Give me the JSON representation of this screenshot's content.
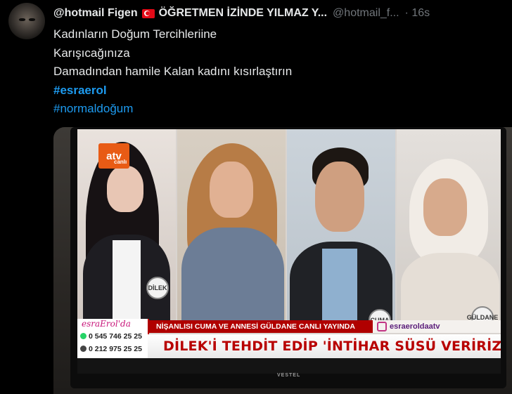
{
  "tweet": {
    "display_name": "@hotmail Figen",
    "display_name_suffix": "ÖĞRETMEN İZİNDE YILMAZ Y...",
    "handle": "@hotmail_f...",
    "time": "· 16s",
    "text_lines": [
      "Kadınların Doğum Tercihleriine",
      "Karışıcağınıza",
      "Damadından hamile Kalan kadını kısırlaştırın"
    ],
    "hashtags": [
      "#esraerol",
      "#normaldoğum"
    ]
  },
  "media": {
    "channel_logo": "atv",
    "channel_sub": "canlı",
    "show_logo": "esraErol'da",
    "phones": [
      "0 545 746 25 25",
      "0 212 975 25 25"
    ],
    "ticker": "NİŞANLISI CUMA VE ANNESİ GÜLDANE CANLI YAYINDA",
    "instagram": "esraeroldaatv",
    "headline": "DİLEK'İ TEHDİT EDİP 'İNTİHAR SÜSÜ VERİRİZ' DEDİLER!",
    "name_tags": [
      "DİLEK",
      "CUMA",
      "GÜLDANE"
    ],
    "tv_brand": "VESTEL"
  },
  "colors": {
    "background": "#000000",
    "text": "#e7e9ea",
    "muted": "#71767b",
    "link": "#1d9bf0",
    "ticker_red": "#b00000"
  }
}
